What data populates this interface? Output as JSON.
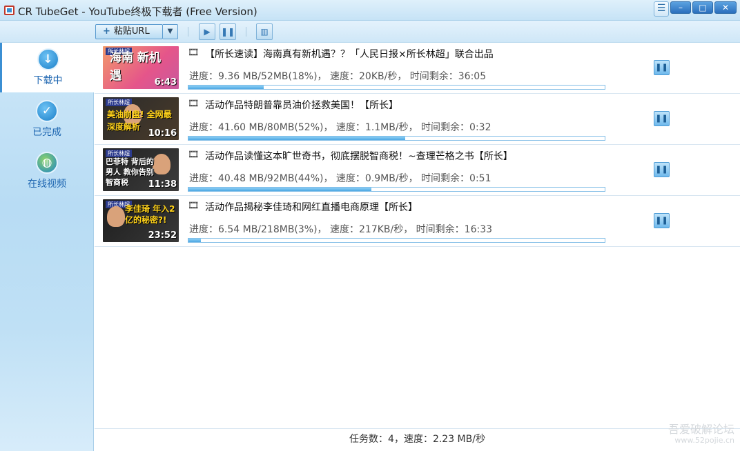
{
  "window": {
    "title": "CR TubeGet - YouTube终极下载者 (Free Version)",
    "buttons": {
      "menu": "☰",
      "minimize": "–",
      "maximize": "□",
      "close": "✕"
    }
  },
  "toolbar": {
    "paste_url_label": "粘贴URL",
    "paste_plus": "+",
    "dropdown_arrow": "▼",
    "start_icon": "play-icon",
    "pause_icon": "pause-icon",
    "delete_icon": "trash-icon"
  },
  "sidebar": {
    "items": [
      {
        "label": "下载中",
        "icon": "download-icon",
        "active": true
      },
      {
        "label": "已完成",
        "icon": "checkmark-icon",
        "active": false
      },
      {
        "label": "在线视频",
        "icon": "globe-icon",
        "active": false
      }
    ]
  },
  "downloads": [
    {
      "thumb_tag": "所长林超",
      "thumb_text": "海南 新机遇",
      "duration": "6:43",
      "title": "【所长速读】海南真有新机遇？？「人民日报×所长林超」联合出品",
      "progress_text": "进度：9.36 MB/52MB(18%)， 速度：20KB/秒， 时间剩余：36:05",
      "progress": 0.18
    },
    {
      "thumb_tag": "所长林超",
      "thumb_text": "美油崩盘! 全网最深度解析",
      "duration": "10:16",
      "title": "活动作品特朗普靠员油价拯救美国！【所长】",
      "progress_text": "进度：41.60 MB/80MB(52%)， 速度：1.1MB/秒， 时间剩余：0:32",
      "progress": 0.52
    },
    {
      "thumb_tag": "所长林超",
      "thumb_text": "巴菲特 背后的男人 教你告别智商税",
      "duration": "11:38",
      "title": "活动作品读懂这本旷世奇书，彻底摆脱智商税！~查理芒格之书【所长】",
      "progress_text": "进度：40.48 MB/92MB(44%)， 速度：0.9MB/秒， 时间剩余：0:51",
      "progress": 0.44
    },
    {
      "thumb_tag": "所长林超",
      "thumb_text": "李佳琦 年入2亿的秘密?!",
      "duration": "23:52",
      "title": "活动作品揭秘李佳琦和网红直播电商原理【所长】",
      "progress_text": "进度：6.54 MB/218MB(3%)， 速度：217KB/秒， 时间剩余：16:33",
      "progress": 0.03
    }
  ],
  "statusbar": {
    "text": "任务数：4，速度：2.23 MB/秒"
  },
  "watermark": {
    "line1": "吾爱破解论坛",
    "line2": "www.52pojie.cn"
  },
  "colors": {
    "accent": "#3b8fd3",
    "progress_fill": "#4ea8e3",
    "sidebar_label": "#1c65b0"
  }
}
